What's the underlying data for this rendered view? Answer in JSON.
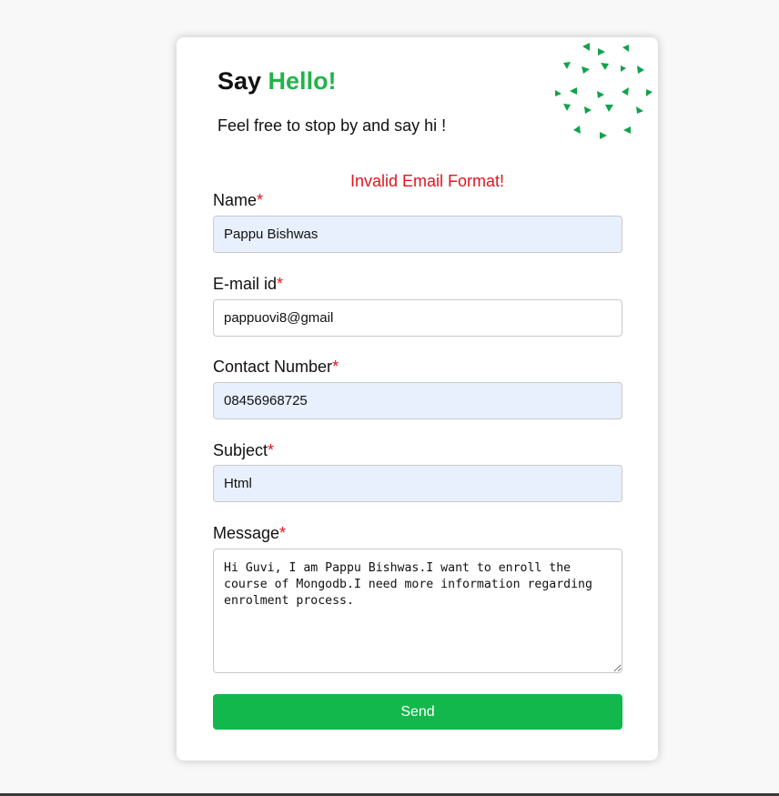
{
  "form": {
    "title_prefix": "Say ",
    "title_accent": "Hello!",
    "subtitle": "Feel free to stop by and say hi !",
    "error": "Invalid Email Format!",
    "required_mark": "*",
    "accent_color": "#22b34a",
    "error_color": "#e3141f",
    "fields": {
      "name": {
        "label": "Name",
        "value": "Pappu Bishwas"
      },
      "email": {
        "label": "E-mail id",
        "value": "pappuovi8@gmail"
      },
      "contact": {
        "label": "Contact Number",
        "value": "08456968725"
      },
      "subject": {
        "label": "Subject",
        "value": "Html"
      },
      "message": {
        "label": "Message",
        "value": "Hi Guvi, I am Pappu Bishwas.I want to enroll the course of Mongodb.I need more information regarding enrolment process."
      }
    },
    "send_label": "Send"
  },
  "decoration": {
    "icon": "triangle-dot-pattern-icon",
    "color": "#11a34a"
  }
}
